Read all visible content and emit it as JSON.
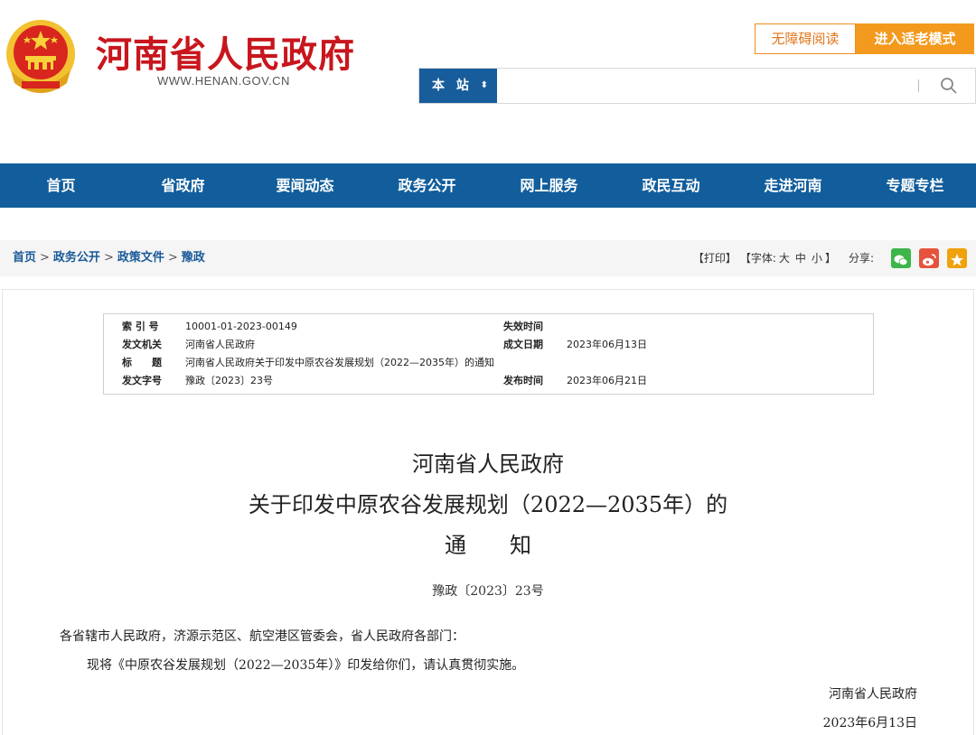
{
  "header": {
    "site_title": "河南省人民政府",
    "site_url_prefix": "WWW.",
    "site_url_domain": "HENAN",
    "site_url_suffix": ".GOV.CN",
    "accessible_label": "无障碍阅读",
    "elder_mode_label": "进入适老模式",
    "search": {
      "scope_label": "本 站",
      "placeholder": "",
      "value": ""
    }
  },
  "nav": {
    "items": [
      "首页",
      "省政府",
      "要闻动态",
      "政务公开",
      "网上服务",
      "政民互动",
      "走进河南",
      "专题专栏"
    ]
  },
  "breadcrumb": {
    "items": [
      "首页",
      "政务公开",
      "政策文件",
      "豫政"
    ],
    "separator": ">"
  },
  "tools": {
    "print_label": "【打印】",
    "font_label": "【字体:",
    "font_large": "大",
    "font_medium": "中",
    "font_small": "小",
    "font_close": "】",
    "share_label": "分享:"
  },
  "meta": {
    "index_no_key": "索 引 号",
    "index_no": "10001-01-2023-00149",
    "expire_key": "失效时间",
    "expire": "",
    "issuer_key": "发文机关",
    "issuer": "河南省人民政府",
    "written_key": "成文日期",
    "written": "2023年06月13日",
    "title_key": "标　　题",
    "title": "河南省人民政府关于印发中原农谷发展规划（2022—2035年）的通知",
    "doc_no_key": "发文字号",
    "doc_no": "豫政〔2023〕23号",
    "publish_key": "发布时间",
    "publish": "2023年06月21日"
  },
  "document": {
    "title_line1": "河南省人民政府",
    "title_line2": "关于印发中原农谷发展规划（2022—2035年）的",
    "title_line3": "通　　知",
    "doc_no": "豫政〔2023〕23号",
    "addressee": "各省辖市人民政府，济源示范区、航空港区管委会，省人民政府各部门：",
    "body": "现将《中原农谷发展规划（2022—2035年）》印发给你们，请认真贯彻实施。",
    "signer": "河南省人民政府",
    "date": "2023年6月13日"
  },
  "colors": {
    "brand_red": "#c8161d",
    "nav_blue": "#125e9c",
    "accent_orange": "#f39a1e"
  }
}
